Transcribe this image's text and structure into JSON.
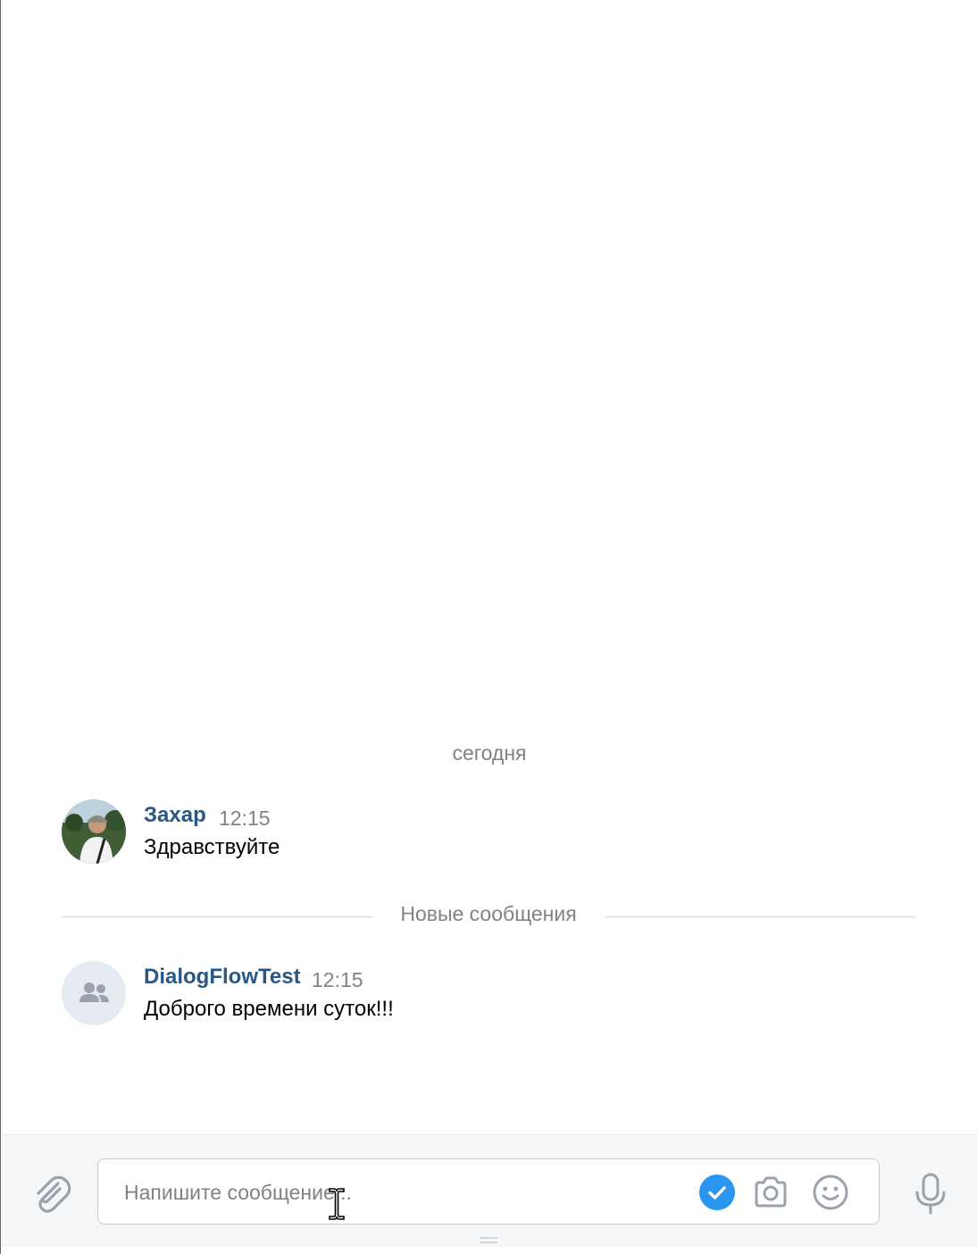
{
  "history": {
    "date_separator": "сегодня",
    "new_messages_separator": "Новые сообщения",
    "messages": [
      {
        "author": "Захар",
        "time": "12:15",
        "text": "Здравствуйте",
        "avatar": "user-photo"
      },
      {
        "author": "DialogFlowTest",
        "time": "12:15",
        "text": "Доброго времени суток!!!",
        "avatar": "group-icon"
      }
    ]
  },
  "composer": {
    "placeholder": "Напишите сообщение...",
    "value": "",
    "icons": {
      "attach": "paperclip-icon",
      "check": "check-circle-icon",
      "camera": "camera-icon",
      "emoji": "smile-icon",
      "voice": "microphone-icon"
    }
  },
  "colors": {
    "author_name": "#2a5885",
    "muted_text": "#828282",
    "accent": "#2a96f0",
    "icon_gray": "#99a2ad",
    "composer_bg": "#f5f6f8"
  }
}
